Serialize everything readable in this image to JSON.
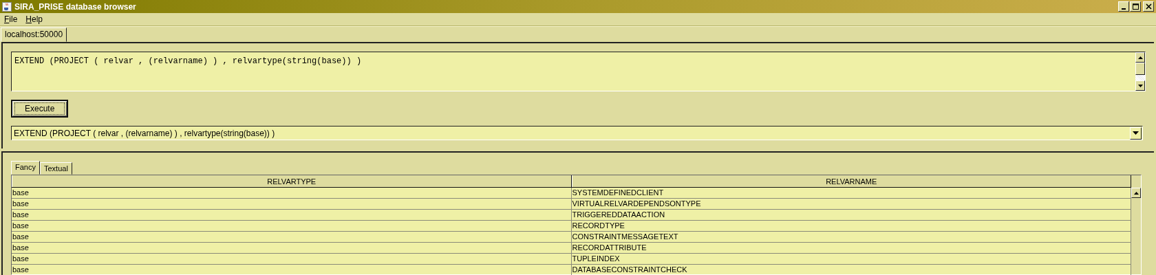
{
  "window": {
    "title": "SIRA_PRISE database browser"
  },
  "menu": [
    {
      "label": "File"
    },
    {
      "label": "Help"
    }
  ],
  "connection_tabs": [
    {
      "label": "localhost:50000"
    }
  ],
  "query": {
    "value": "EXTEND (PROJECT ( relvar , (relvarname) ) , relvartype(string(base)) )"
  },
  "execute_button": "Execute",
  "history": {
    "value": "EXTEND (PROJECT ( relvar , (relvarname) ) , relvartype(string(base)) )"
  },
  "result_tabs": [
    {
      "label": "Fancy",
      "selected": true
    },
    {
      "label": "Textual",
      "selected": false
    }
  ],
  "table": {
    "columns": [
      "RELVARTYPE",
      "RELVARNAME"
    ],
    "rows": [
      [
        "base",
        "SYSTEMDEFINEDCLIENT"
      ],
      [
        "base",
        "VIRTUALRELVARDEPENDSONTYPE"
      ],
      [
        "base",
        "TRIGGEREDDATAACTION"
      ],
      [
        "base",
        "RECORDTYPE"
      ],
      [
        "base",
        "CONSTRAINTMESSAGETEXT"
      ],
      [
        "base",
        "RECORDATTRIBUTE"
      ],
      [
        "base",
        "TUPLEINDEX"
      ],
      [
        "base",
        "DATABASECONSTRAINTCHECK"
      ]
    ]
  }
}
